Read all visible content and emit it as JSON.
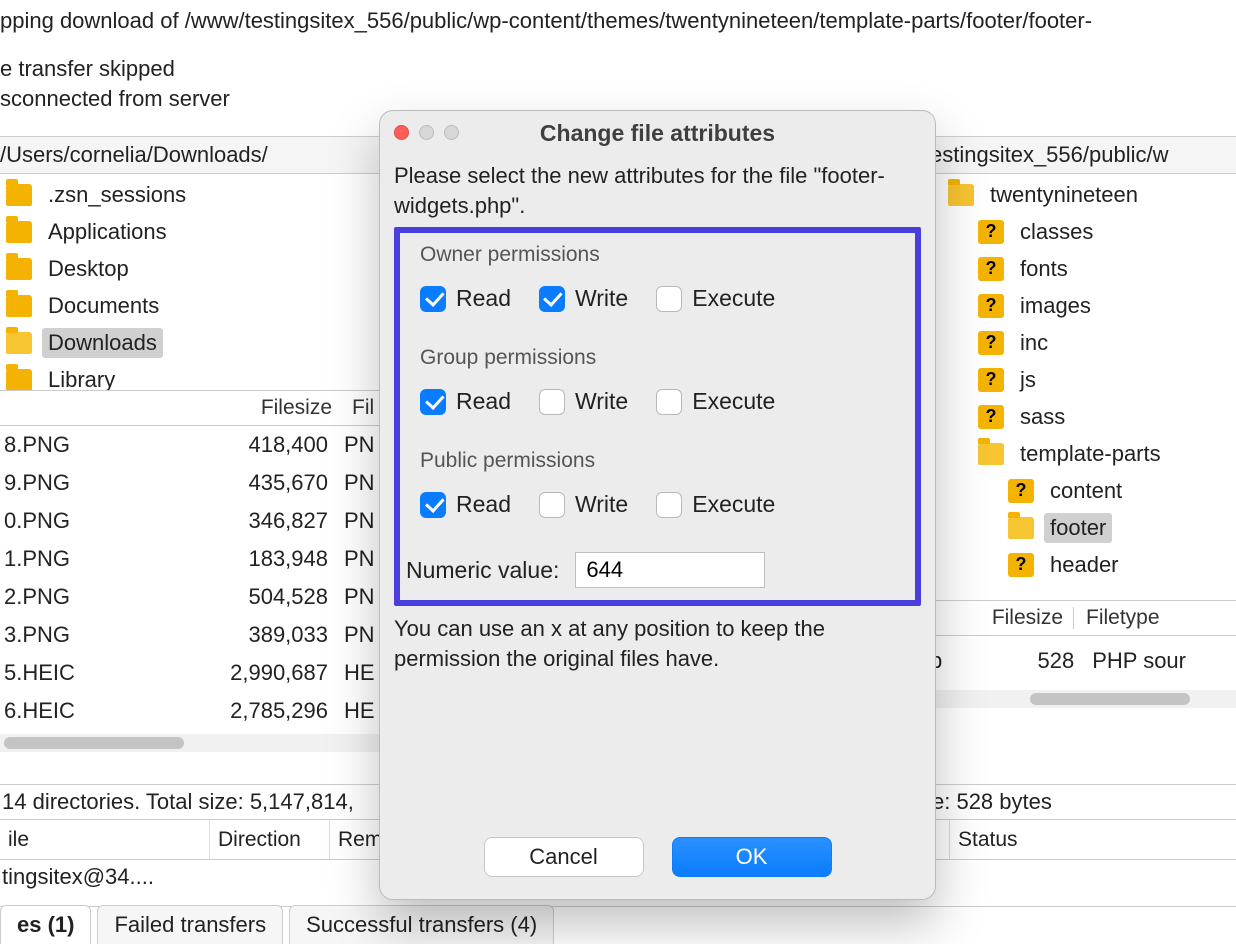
{
  "log": {
    "l1": "pping download of /www/testingsitex_556/public/wp-content/themes/twentynineteen/template-parts/footer/footer-",
    "l2": "e transfer skipped",
    "l3": "sconnected from server"
  },
  "paths": {
    "local": "/Users/cornelia/Downloads/",
    "remote": "estingsitex_556/public/w"
  },
  "localTree": [
    {
      "label": ".zsn_sessions",
      "selected": false
    },
    {
      "label": "Applications",
      "selected": false
    },
    {
      "label": "Desktop",
      "selected": false
    },
    {
      "label": "Documents",
      "selected": false
    },
    {
      "label": "Downloads",
      "selected": true
    },
    {
      "label": "Library",
      "selected": false
    }
  ],
  "localListHeaders": {
    "size": "Filesize",
    "type": "Fil"
  },
  "localFiles": [
    {
      "name": "8.PNG",
      "size": "418,400",
      "type": "PN"
    },
    {
      "name": "9.PNG",
      "size": "435,670",
      "type": "PN"
    },
    {
      "name": "0.PNG",
      "size": "346,827",
      "type": "PN"
    },
    {
      "name": "1.PNG",
      "size": "183,948",
      "type": "PN"
    },
    {
      "name": "2.PNG",
      "size": "504,528",
      "type": "PN"
    },
    {
      "name": "3.PNG",
      "size": "389,033",
      "type": "PN"
    },
    {
      "name": "5.HEIC",
      "size": "2,990,687",
      "type": "HE"
    },
    {
      "name": "6.HEIC",
      "size": "2,785,296",
      "type": "HE"
    }
  ],
  "remoteTree": {
    "root": "twentynineteen",
    "children1": [
      "classes",
      "fonts",
      "images",
      "inc",
      "js",
      "sass"
    ],
    "tp": "template-parts",
    "children2": [
      {
        "label": "content",
        "sel": false
      },
      {
        "label": "footer",
        "sel": true
      },
      {
        "label": "header",
        "sel": false
      }
    ]
  },
  "remoteListHeaders": {
    "size": "Filesize",
    "type": "Filetype"
  },
  "remoteRow": {
    "p": "p",
    "size": "528",
    "type": "PHP sour"
  },
  "statusLeft": "14 directories. Total size: 5,147,814,",
  "statusRight": "e: 528 bytes",
  "queueHeaders": {
    "file": "ile",
    "dir": "Direction",
    "rem": "Rem",
    "status": "Status"
  },
  "queueRow": "tingsitex@34....",
  "tabs": {
    "t1": "es (1)",
    "t2": "Failed transfers",
    "t3": "Successful transfers (4)"
  },
  "dialog": {
    "title": "Change file attributes",
    "intro": "Please select the new attributes for the file \"footer-widgets.php\".",
    "groups": {
      "owner": "Owner permissions",
      "group": "Group permissions",
      "public": "Public permissions"
    },
    "labels": {
      "read": "Read",
      "write": "Write",
      "execute": "Execute"
    },
    "perm": {
      "owner": {
        "read": true,
        "write": true,
        "execute": false
      },
      "group": {
        "read": true,
        "write": false,
        "execute": false
      },
      "public": {
        "read": true,
        "write": false,
        "execute": false
      }
    },
    "numericLabel": "Numeric value:",
    "numericValue": "644",
    "hint": "You can use an x at any position to keep the permission the original files have.",
    "cancel": "Cancel",
    "ok": "OK"
  }
}
